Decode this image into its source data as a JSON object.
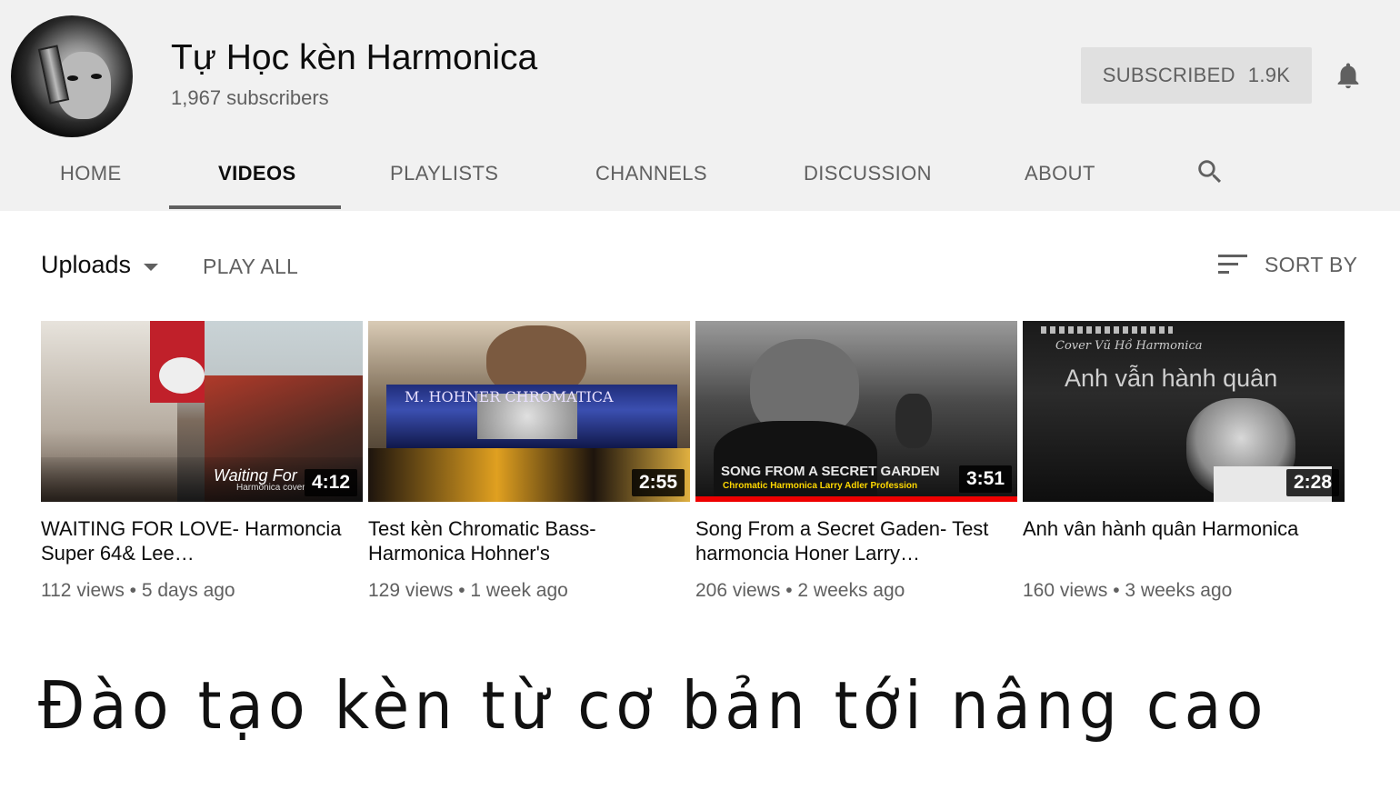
{
  "channel": {
    "name": "Tự Học kèn Harmonica",
    "subscribers": "1,967 subscribers",
    "subscribe_button": {
      "label": "SUBSCRIBED",
      "count": "1.9K"
    }
  },
  "tabs": [
    {
      "label": "HOME",
      "active": false
    },
    {
      "label": "VIDEOS",
      "active": true
    },
    {
      "label": "PLAYLISTS",
      "active": false
    },
    {
      "label": "CHANNELS",
      "active": false
    },
    {
      "label": "DISCUSSION",
      "active": false
    },
    {
      "label": "ABOUT",
      "active": false
    }
  ],
  "toolbar": {
    "uploads_label": "Uploads",
    "play_all_label": "PLAY ALL",
    "sort_label": "SORT BY"
  },
  "videos": [
    {
      "title": "WAITING FOR LOVE- Harmoncia Super 64& Lee…",
      "duration": "4:12",
      "views": "112 views",
      "age": "5 days ago",
      "overlay": "Waiting For",
      "overlay2": "Harmonica cover",
      "progress": 0
    },
    {
      "title": "Test kèn Chromatic Bass- Harmonica Hohner's",
      "duration": "2:55",
      "views": "129 views",
      "age": "1 week ago",
      "overlay": "M. HOHNER CHROMATICA",
      "progress": 0
    },
    {
      "title": "Song From a Secret Gaden- Test harmoncia Honer Larry…",
      "duration": "3:51",
      "views": "206 views",
      "age": "2 weeks ago",
      "overlay": "SONG FROM A SECRET GARDEN",
      "overlay2": "Chromatic Harmonica Larry Adler Profession",
      "progress": 1
    },
    {
      "title": "Anh vân hành quân Harmonica",
      "duration": "2:28",
      "views": "160 views",
      "age": "3 weeks ago",
      "overlay": "Anh vẫn hành quân",
      "overlay2": "Cover Vũ Hồ Harmonica",
      "progress": 0
    }
  ],
  "tagline": "Đào tạo kèn từ cơ bản tới nâng cao",
  "colors": {
    "header_bg": "#f1f1f1",
    "text_secondary": "#606060",
    "progress_red": "#e00000"
  }
}
